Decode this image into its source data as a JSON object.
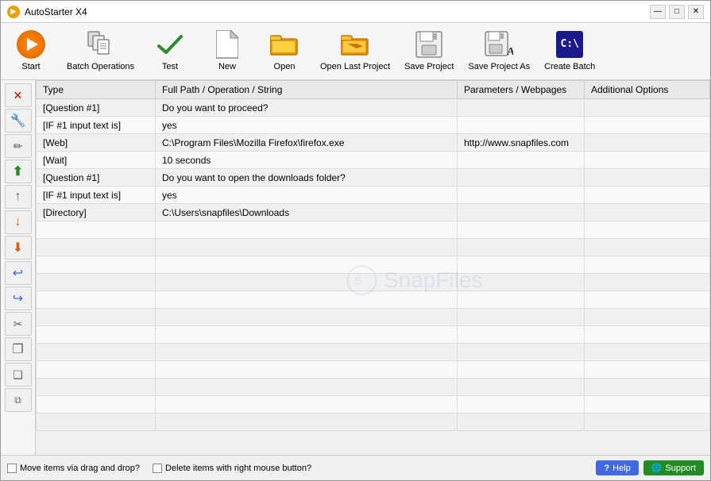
{
  "titleBar": {
    "title": "AutoStarter X4",
    "controls": {
      "minimize": "—",
      "maximize": "□",
      "close": "✕"
    }
  },
  "toolbar": {
    "buttons": [
      {
        "id": "start",
        "label": "Start",
        "iconType": "start"
      },
      {
        "id": "batch-operations",
        "label": "Batch Operations",
        "iconType": "batch"
      },
      {
        "id": "test",
        "label": "Test",
        "iconType": "test"
      },
      {
        "id": "new",
        "label": "New",
        "iconType": "doc"
      },
      {
        "id": "open",
        "label": "Open",
        "iconType": "folder"
      },
      {
        "id": "open-last-project",
        "label": "Open Last Project",
        "iconType": "folder-open"
      },
      {
        "id": "save-project",
        "label": "Save Project",
        "iconType": "save"
      },
      {
        "id": "save-project-as",
        "label": "Save Project As",
        "iconType": "save-as"
      },
      {
        "id": "create-batch",
        "label": "Create Batch",
        "iconType": "cmd"
      }
    ]
  },
  "sidebar": {
    "buttons": [
      {
        "id": "delete",
        "label": "✕",
        "title": "Delete",
        "type": "delete"
      },
      {
        "id": "edit",
        "label": "✎",
        "title": "Edit",
        "type": "edit"
      },
      {
        "id": "pencil",
        "label": "✏",
        "title": "Rename",
        "type": "edit"
      },
      {
        "id": "move-top",
        "label": "⬆",
        "title": "Move to Top",
        "type": "nav"
      },
      {
        "id": "move-up",
        "label": "↑",
        "title": "Move Up",
        "type": "nav"
      },
      {
        "id": "move-down",
        "label": "↓",
        "title": "Move Down",
        "type": "nav"
      },
      {
        "id": "move-bottom",
        "label": "⬇",
        "title": "Move to Bottom",
        "type": "nav"
      },
      {
        "id": "undo",
        "label": "↩",
        "title": "Undo",
        "type": "edit"
      },
      {
        "id": "redo",
        "label": "↪",
        "title": "Redo",
        "type": "edit"
      },
      {
        "id": "cut",
        "label": "✂",
        "title": "Cut",
        "type": "edit"
      },
      {
        "id": "copy-doc",
        "label": "❒",
        "title": "Copy",
        "type": "edit"
      },
      {
        "id": "paste-doc",
        "label": "❑",
        "title": "Paste",
        "type": "edit"
      },
      {
        "id": "duplicate",
        "label": "⧉",
        "title": "Duplicate",
        "type": "edit"
      }
    ]
  },
  "table": {
    "columns": [
      {
        "id": "type",
        "label": "Type"
      },
      {
        "id": "path",
        "label": "Full Path / Operation / String"
      },
      {
        "id": "params",
        "label": "Parameters / Webpages"
      },
      {
        "id": "options",
        "label": "Additional Options"
      }
    ],
    "rows": [
      {
        "type": "[Question #1]",
        "path": "Do you want to proceed?",
        "params": "",
        "options": ""
      },
      {
        "type": "[IF #1 input text is]",
        "path": "yes",
        "params": "",
        "options": ""
      },
      {
        "type": "[Web]",
        "path": "C:\\Program Files\\Mozilla Firefox\\firefox.exe",
        "params": "http://www.snapfiles.com",
        "options": ""
      },
      {
        "type": "[Wait]",
        "path": "10 seconds",
        "params": "",
        "options": ""
      },
      {
        "type": "[Question #1]",
        "path": "Do you want to open the downloads folder?",
        "params": "",
        "options": ""
      },
      {
        "type": "[IF #1 input text is]",
        "path": "yes",
        "params": "",
        "options": ""
      },
      {
        "type": "[Directory]",
        "path": "C:\\Users\\snapfiles\\Downloads",
        "params": "",
        "options": ""
      }
    ],
    "emptyRows": 12
  },
  "statusBar": {
    "checkbox1Label": "Move items via drag and drop?",
    "checkbox2Label": "Delete items with right mouse button?",
    "helpLabel": "Help",
    "supportLabel": "Support"
  },
  "watermark": {
    "text": "SnapFiles"
  }
}
